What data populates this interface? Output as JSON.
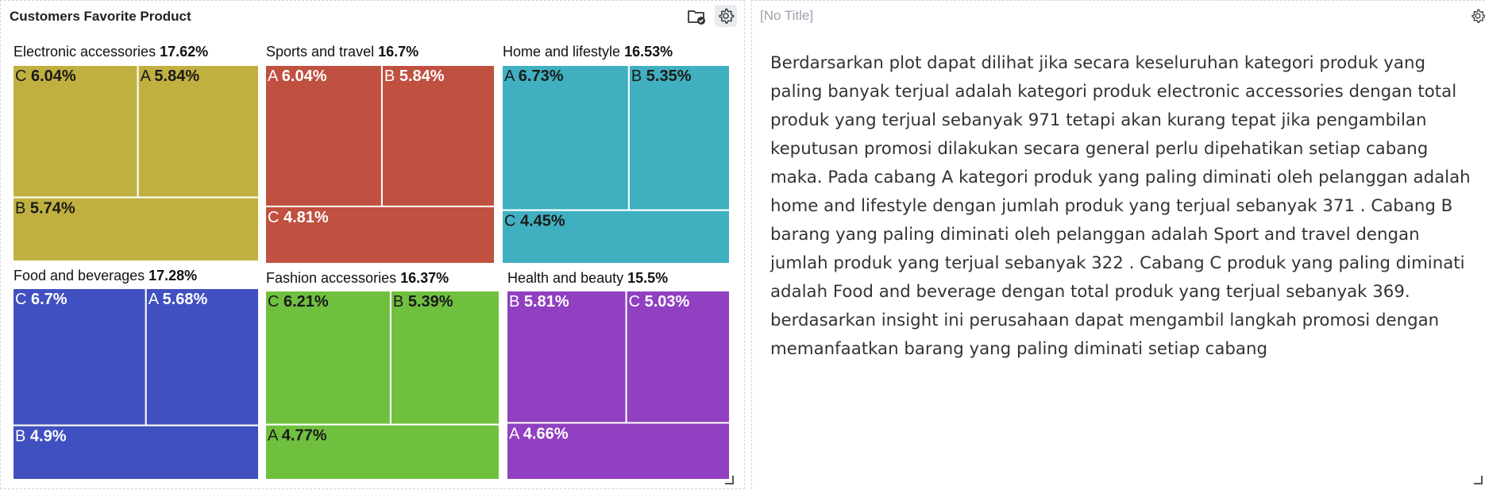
{
  "left_panel": {
    "title": "Customers Favorite Product",
    "toolbar": {
      "folder_icon": "folder-check-icon",
      "settings_icon": "gear-icon"
    }
  },
  "right_panel": {
    "title": "[No Title]",
    "toolbar": {
      "settings_icon": "gear-icon"
    },
    "insight": "Berdarsarkan plot dapat dilihat jika secara keseluruhan kategori produk yang paling banyak terjual adalah kategori produk electronic accessories dengan total produk yang terjual sebanyak 971 tetapi akan kurang tepat jika pengambilan keputusan promosi dilakukan secara general perlu dipehatikan setiap cabang maka. Pada cabang A kategori produk yang paling diminati oleh pelanggan adalah home and lifestyle dengan jumlah produk yang terjual sebanyak 371 . Cabang B barang yang paling diminati oleh pelanggan adalah Sport and travel dengan jumlah produk yang terjual sebanyak 322 . Cabang C produk yang paling diminati adalah Food and beverage dengan total produk yang terjual sebanyak 369. berdasarkan insight ini perusahaan dapat mengambil langkah promosi dengan memanfaatkan barang yang paling diminati setiap cabang"
  },
  "chart_data": {
    "type": "treemap",
    "title": "Customers Favorite Product",
    "groups": [
      {
        "name": "Electronic accessories",
        "label": "17.62%",
        "color": "#c0b040",
        "children": [
          {
            "name": "C",
            "label": "6.04%",
            "value": 6.04
          },
          {
            "name": "A",
            "label": "5.84%",
            "value": 5.84
          },
          {
            "name": "B",
            "label": "5.74%",
            "value": 5.74
          }
        ]
      },
      {
        "name": "Sports and travel",
        "label": "16.7%",
        "color": "#c05040",
        "children": [
          {
            "name": "A",
            "label": "6.04%",
            "value": 6.04
          },
          {
            "name": "B",
            "label": "5.84%",
            "value": 5.84
          },
          {
            "name": "C",
            "label": "4.81%",
            "value": 4.81
          }
        ]
      },
      {
        "name": "Home and lifestyle",
        "label": "16.53%",
        "color": "#40b0c0",
        "children": [
          {
            "name": "A",
            "label": "6.73%",
            "value": 6.73
          },
          {
            "name": "B",
            "label": "5.35%",
            "value": 5.35
          },
          {
            "name": "C",
            "label": "4.45%",
            "value": 4.45
          }
        ]
      },
      {
        "name": "Food and beverages",
        "label": "17.28%",
        "color": "#4050c0",
        "children": [
          {
            "name": "C",
            "label": "6.7%",
            "value": 6.7
          },
          {
            "name": "A",
            "label": "5.68%",
            "value": 5.68
          },
          {
            "name": "B",
            "label": "4.9%",
            "value": 4.9
          }
        ]
      },
      {
        "name": "Fashion accessories",
        "label": "16.37%",
        "color": "#70c040",
        "children": [
          {
            "name": "C",
            "label": "6.21%",
            "value": 6.21
          },
          {
            "name": "B",
            "label": "5.39%",
            "value": 5.39
          },
          {
            "name": "A",
            "label": "4.77%",
            "value": 4.77
          }
        ]
      },
      {
        "name": "Health and beauty",
        "label": "15.5%",
        "color": "#9040c0",
        "children": [
          {
            "name": "B",
            "label": "5.81%",
            "value": 5.81
          },
          {
            "name": "C",
            "label": "5.03%",
            "value": 5.03
          },
          {
            "name": "A",
            "label": "4.66%",
            "value": 4.66
          }
        ]
      }
    ]
  }
}
